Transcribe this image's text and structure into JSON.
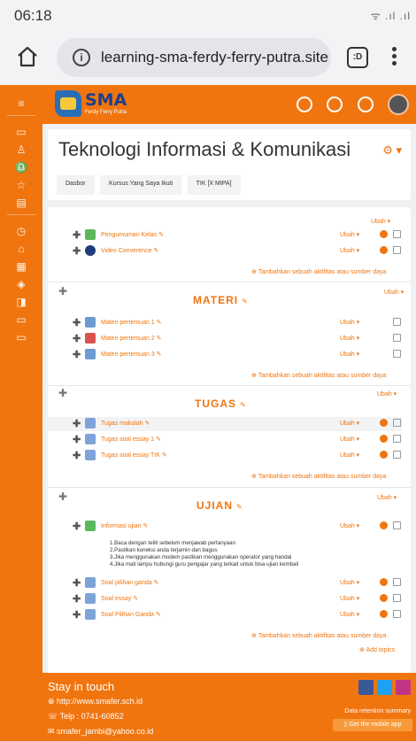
{
  "status_bar": {
    "time": "06:18",
    "signal_text": "ᯤ .ıl .ıl"
  },
  "browser": {
    "url": "learning-sma-ferdy-ferry-putra.site",
    "tabs_label": ":D"
  },
  "site": {
    "logo_text": "SMA",
    "logo_subtext": "Ferdy Ferry Putra"
  },
  "course": {
    "title": "Teknologi Informasi & Komunikasi",
    "breadcrumbs": [
      "Dasbor",
      "Kursus Yang Saya Ikuti",
      "TIK [X MIPA]"
    ]
  },
  "edit_label": "Ubah ▾",
  "add_activity_label": "Tambahkan sebuah aktifitas atau sumber daya",
  "section0": {
    "activities": [
      {
        "name": "Pengumuman Kelas",
        "icon": "forum-icon",
        "color": "#5cb85c"
      },
      {
        "name": "Video Converence",
        "icon": "bigbluebutton-icon",
        "color": "#1f3d7a"
      }
    ]
  },
  "materi": {
    "title": "MATERI",
    "activities": [
      {
        "name": "Materi pertemuan 1",
        "icon": "file-icon",
        "color": "#6b9bd1"
      },
      {
        "name": "Materi pertemuan 2",
        "icon": "pdf-icon",
        "color": "#d9534f"
      },
      {
        "name": "Materi pertemuan 3",
        "icon": "file-icon",
        "color": "#6b9bd1"
      }
    ]
  },
  "tugas": {
    "title": "TUGAS",
    "activities": [
      {
        "name": "Tugas makalah",
        "icon": "assignment-icon",
        "color": "#7fa3d8"
      },
      {
        "name": "Tugas soal essay 1",
        "icon": "quiz-icon",
        "color": "#7fa3d8"
      },
      {
        "name": "Tugas soal essay TIK",
        "icon": "quiz-icon",
        "color": "#7fa3d8"
      }
    ]
  },
  "ujian": {
    "title": "UJIAN",
    "info": {
      "name": "Informasi ujian",
      "icon": "forum-icon",
      "color": "#5cb85c"
    },
    "instructions": [
      "1.Baca dengan teliti sebelum menjawab pertanyaan",
      "2.Pastikan koneksi anda terjamin dan bagus",
      "3.Jika menggunakan modem pastikan menggunakan operator yang handal",
      "4.Jika mati lampu hubungi guru pengajar yang terkait untuk bisa ujian kembali"
    ],
    "activities": [
      {
        "name": "Soal pilihan ganda",
        "icon": "quiz-icon",
        "color": "#7fa3d8"
      },
      {
        "name": "Soal essay",
        "icon": "quiz-icon",
        "color": "#7fa3d8"
      },
      {
        "name": "Soal Pilihan Ganda",
        "icon": "quiz-icon",
        "color": "#7fa3d8"
      }
    ]
  },
  "add_topics_label": "Add topics",
  "footer": {
    "title": "Stay in touch",
    "website": "http://www.smafer.sch.id",
    "phone": "Telp : 0741-60852",
    "email": "smafer_jambi@yahoo.co.id",
    "data_retention": "Data retention summary",
    "mobile_app": "Get the mobile app"
  },
  "colors": {
    "accent": "#f0750f",
    "page_bg": "#eef0f1"
  }
}
